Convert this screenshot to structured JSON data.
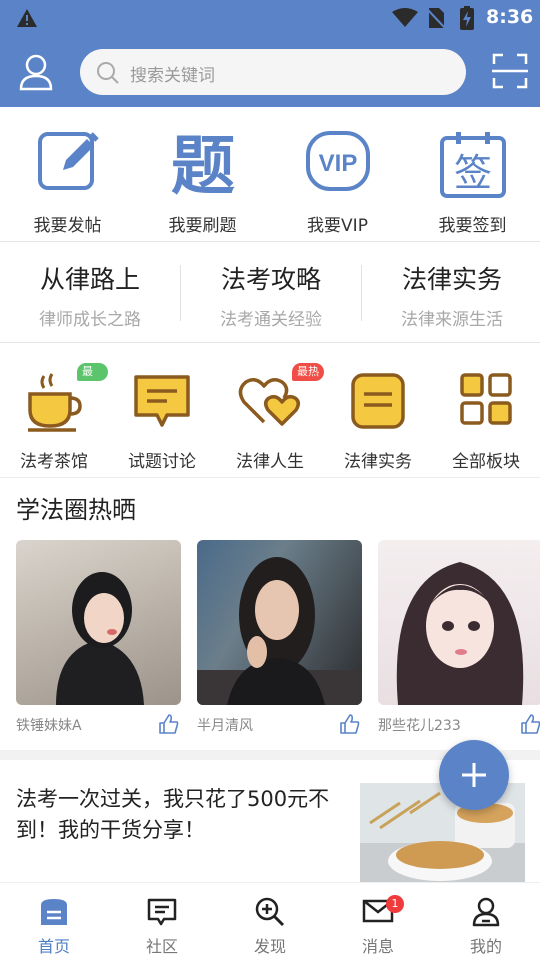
{
  "status_bar": {
    "time": "8:36"
  },
  "search": {
    "placeholder": "搜索关键词"
  },
  "colors": {
    "primary": "#5b84c8",
    "accent_yellow": "#f5c842",
    "icon_brown": "#8b5a1e"
  },
  "quick_actions": [
    {
      "label": "我要发帖",
      "icon": "edit-icon"
    },
    {
      "label": "我要刷题",
      "icon": "question-char-icon",
      "glyph": "题"
    },
    {
      "label": "我要VIP",
      "icon": "vip-icon",
      "glyph": "VIP"
    },
    {
      "label": "我要签到",
      "icon": "sign-in-calendar-icon",
      "glyph": "签"
    }
  ],
  "topics": [
    {
      "title": "从律路上",
      "subtitle": "律师成长之路"
    },
    {
      "title": "法考攻略",
      "subtitle": "法考通关经验"
    },
    {
      "title": "法律实务",
      "subtitle": "法律来源生活"
    }
  ],
  "categories": [
    {
      "label": "法考茶馆",
      "icon": "teacup-icon",
      "badge": "最新"
    },
    {
      "label": "试题讨论",
      "icon": "chat-board-icon"
    },
    {
      "label": "法律人生",
      "icon": "hearts-icon",
      "badge": "最热"
    },
    {
      "label": "法律实务",
      "icon": "note-icon"
    },
    {
      "label": "全部板块",
      "icon": "grid-icon"
    }
  ],
  "hot_section": {
    "title": "学法圈热晒",
    "posts": [
      {
        "user": "铁锤妹妹A",
        "icon": "thumbs-up-icon"
      },
      {
        "user": "半月清风",
        "icon": "thumbs-up-icon"
      },
      {
        "user": "那些花儿233",
        "icon": "thumbs-up-icon"
      }
    ]
  },
  "article": {
    "title": "法考一次过关，我只花了500元不到！我的干货分享！"
  },
  "bottom_nav": [
    {
      "label": "首页",
      "icon": "home-icon",
      "active": true
    },
    {
      "label": "社区",
      "icon": "community-icon"
    },
    {
      "label": "发现",
      "icon": "discover-icon"
    },
    {
      "label": "消息",
      "icon": "mail-icon",
      "badge": "1"
    },
    {
      "label": "我的",
      "icon": "profile-icon"
    }
  ]
}
